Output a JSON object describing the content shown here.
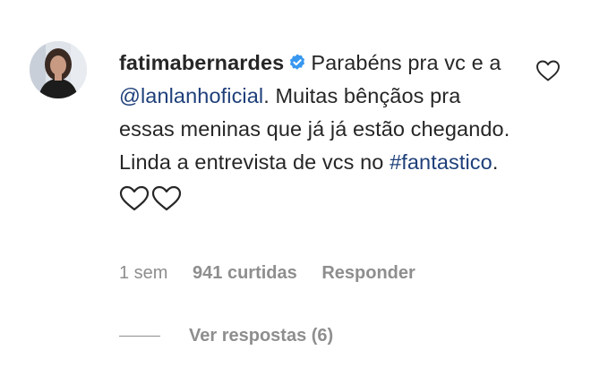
{
  "comment": {
    "avatar_icon": "profile-photo",
    "username": "fatimabernardes",
    "verified_icon": "verified-badge-icon",
    "text_part1": "Parabéns pra vc e a ",
    "mention": "@lanlanhoficial",
    "text_part2": ". Muitas bênçãos pra essas meninas que já já estão chegando. Linda a entrevista de vcs no ",
    "hashtag": "#fantastico",
    "text_part3": ".",
    "emoji": [
      "♡",
      "♡"
    ],
    "like_icon": "heart-outline-icon"
  },
  "meta": {
    "time": "1 sem",
    "likes": "941 curtidas",
    "reply": "Responder"
  },
  "replies": {
    "label": "Ver respostas (6)"
  },
  "colors": {
    "text": "#262626",
    "secondary": "#8e8e8e",
    "link": "#1e3f7a",
    "verified": "#3897f0"
  }
}
